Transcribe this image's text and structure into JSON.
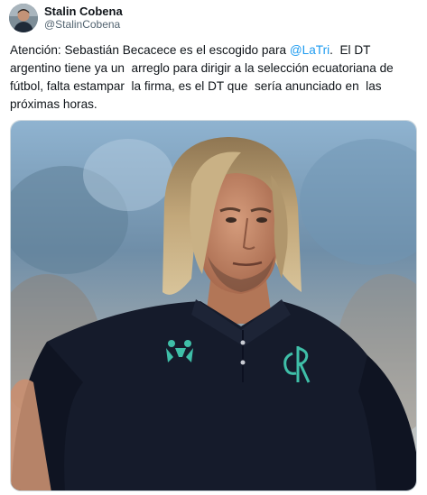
{
  "author": {
    "display_name": "Stalin Cobena",
    "handle": "@StalinCobena"
  },
  "tweet": {
    "text_before_mention": "Atención: Sebastián Becacece es el escogido para ",
    "mention": "@LaTri",
    "text_after_mention": ".  El DT argentino tiene ya un  arreglo para dirigir a la selección ecuatoriana de fútbol, falta estampar  la firma, es el DT que  sería anunciado en  las próximas horas."
  },
  "media": {
    "description_alt": "",
    "shirt_brand": "kappa",
    "colors": {
      "shirt": "#151b2b",
      "logo": "#3fbfa8",
      "hair": "#b59a6c",
      "skin": "#c98f70",
      "background_sky": "#8fb3d0"
    }
  }
}
